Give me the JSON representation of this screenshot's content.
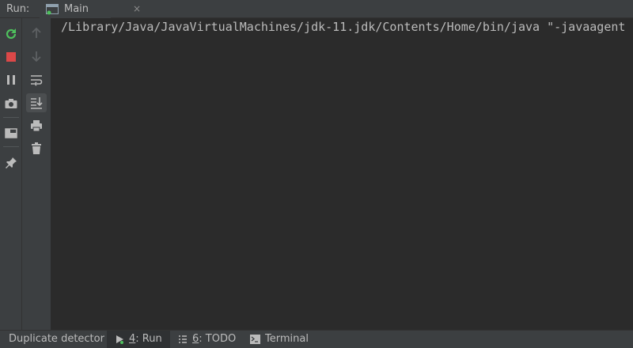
{
  "header": {
    "run_label": "Run:",
    "tab": {
      "label": "Main",
      "close": "×"
    }
  },
  "console": {
    "lines": [
      "/Library/Java/JavaVirtualMachines/jdk-11.jdk/Contents/Home/bin/java \"-javaagent"
    ]
  },
  "left_toolbar": {
    "icons": [
      "rerun-icon",
      "stop-icon",
      "pause-icon",
      "camera-icon",
      "layout-icon",
      "pin-icon"
    ]
  },
  "console_toolbar": {
    "icons": [
      "up-arrow-icon",
      "down-arrow-icon",
      "soft-wrap-icon",
      "scroll-to-end-icon",
      "print-icon",
      "trash-icon"
    ]
  },
  "bottom_bar": {
    "items": [
      {
        "label": "Duplicate detector"
      },
      {
        "mnemonic": "4",
        "label": ": Run"
      },
      {
        "mnemonic": "6",
        "label": ": TODO"
      },
      {
        "label": "Terminal"
      }
    ]
  },
  "colors": {
    "background": "#2b2b2b",
    "panel": "#3c3f41",
    "rerun_green": "#4ec15d",
    "stop_red": "#db4848",
    "text": "#bbbbbb"
  }
}
